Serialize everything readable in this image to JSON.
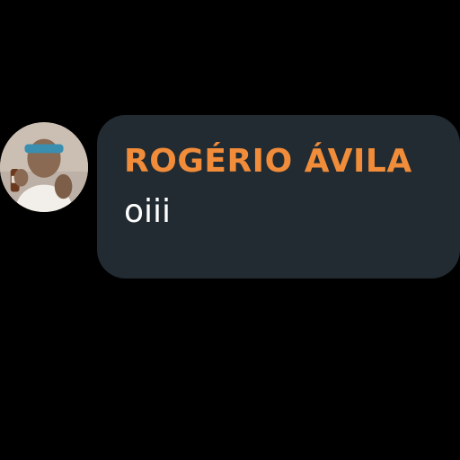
{
  "chat": {
    "sender_name": "ROGÉRIO ÁVILA",
    "message_text": "oiii",
    "avatar_icon": "user-avatar-photo"
  },
  "colors": {
    "background": "#000000",
    "bubble_background": "#222b31",
    "sender_name_color": "#f08c3a",
    "message_text_color": "#ffffff"
  }
}
